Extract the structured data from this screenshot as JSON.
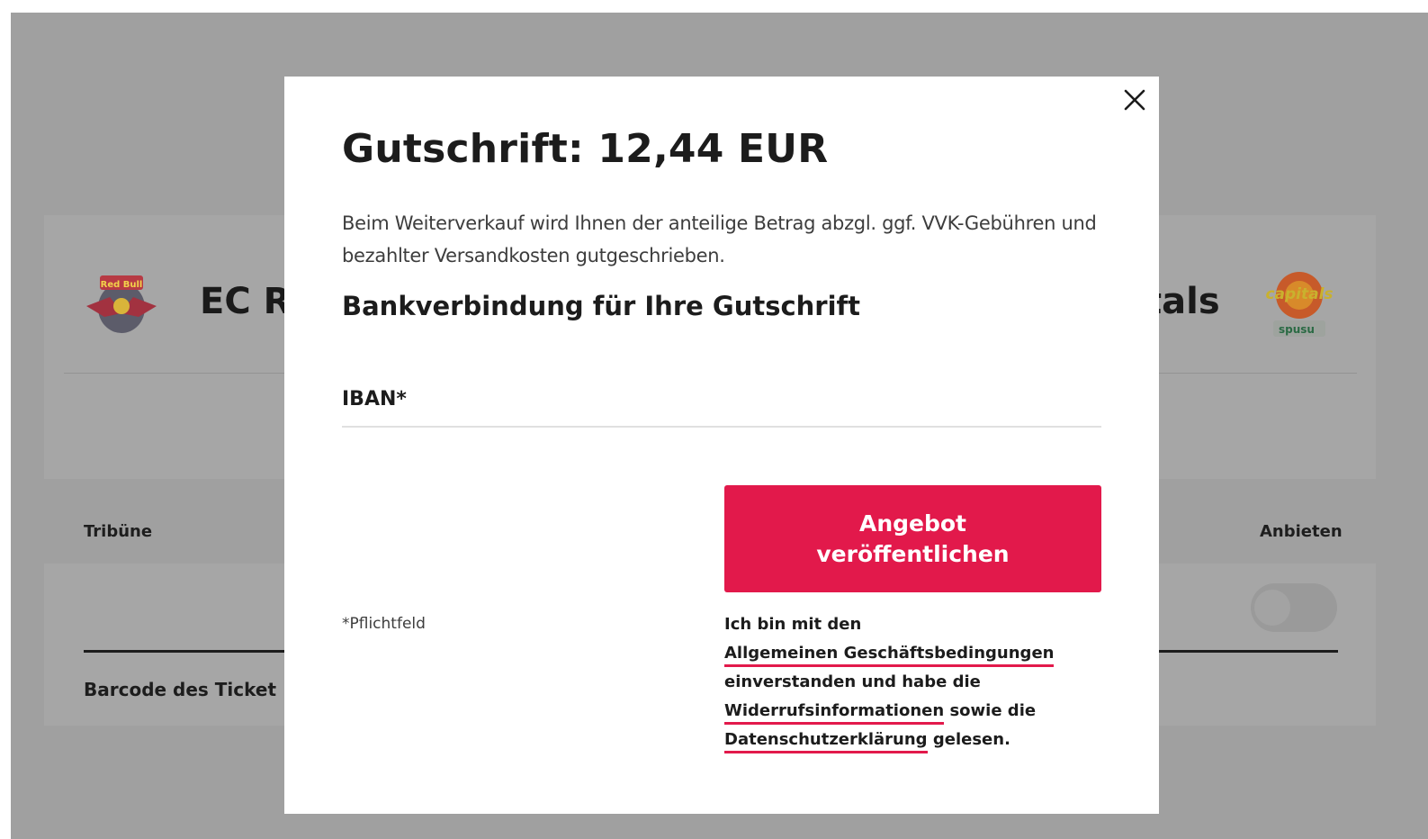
{
  "background": {
    "team_left": "EC R",
    "team_right": "tals",
    "column_tribune": "Tribüne",
    "column_offer": "Anbieten",
    "barcode_label": "Barcode des Ticket",
    "logo_left_text": "Red Bull",
    "logo_right_text": "capitals",
    "logo_right_sponsor": "spusu"
  },
  "modal": {
    "title": "Gutschrift: 12,44 EUR",
    "intro": "Beim Weiterverkauf wird Ihnen der anteilige Betrag abzgl. ggf. VVK-Gebühren und bezahlter Versandkosten gutgeschrieben.",
    "section_title": "Bankverbindung für Ihre Gutschrift",
    "iban_label": "IBAN*",
    "iban_value": "",
    "submit_label": "Angebot veröffentlichen",
    "required_note": "*Pflichtfeld",
    "terms": {
      "prefix": "Ich bin mit den",
      "agb_link": "Allgemeinen Geschäftsbedingungen",
      "middle": "einverstanden und habe die",
      "widerruf_link": "Widerrufsinformationen",
      "sowie": "sowie die",
      "datenschutz_link": "Datenschutzerklärung",
      "suffix": "gelesen."
    }
  },
  "colors": {
    "overlay": "#a0a0a0",
    "accent": "#e2194b",
    "text": "#1c1c1c"
  },
  "icons": {
    "close": "close-icon"
  }
}
